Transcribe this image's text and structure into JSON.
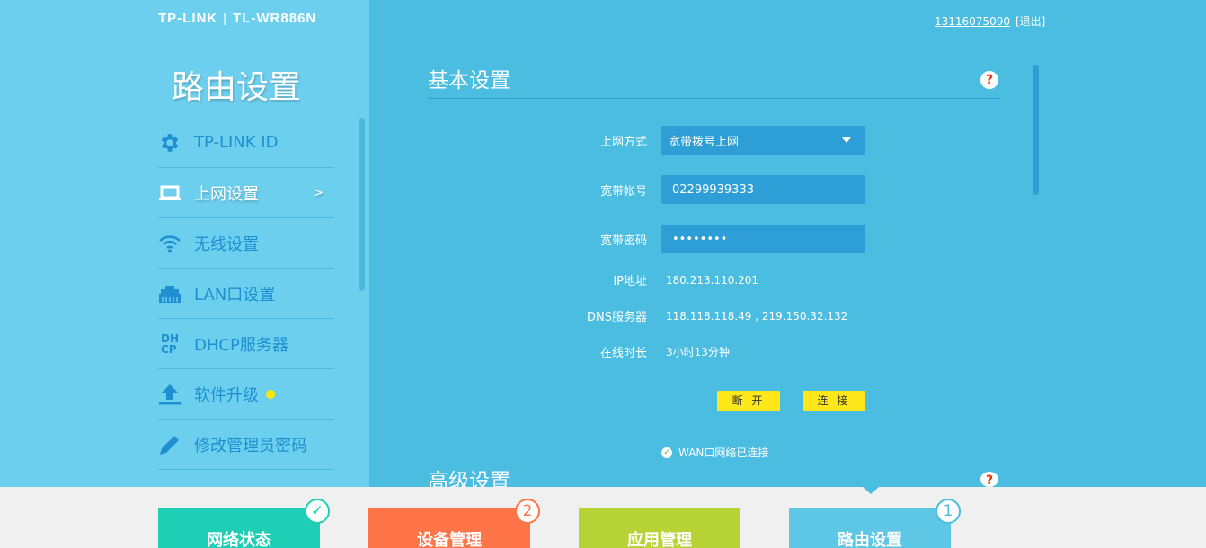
{
  "header": {
    "brand": "TP-LINK",
    "model": "TL-WR886N",
    "account": "13116075090",
    "logout": "[退出]"
  },
  "sidebar": {
    "title": "路由设置",
    "items": [
      {
        "label": "TP-LINK ID",
        "icon": "gear-icon"
      },
      {
        "label": "上网设置",
        "icon": "laptop-icon",
        "arrow": ">"
      },
      {
        "label": "无线设置",
        "icon": "wifi-icon"
      },
      {
        "label": "LAN口设置",
        "icon": "lan-port-icon"
      },
      {
        "label": "DHCP服务器",
        "icon": "dhcp-icon"
      },
      {
        "label": "软件升级",
        "icon": "upload-icon"
      },
      {
        "label": "修改管理员密码",
        "icon": "pencil-icon"
      }
    ]
  },
  "basic": {
    "title": "基本设置",
    "help": "?",
    "conn_type_label": "上网方式",
    "conn_type_value": "宽带拨号上网",
    "account_label": "宽带帐号",
    "account_value": "02299939333",
    "password_label": "宽带密码",
    "password_value": "••••••••",
    "ip_label": "IP地址",
    "ip_value": "180.213.110.201",
    "dns_label": "DNS服务器",
    "dns_value": "118.118.118.49 , 219.150.32.132",
    "uptime_label": "在线时长",
    "uptime_value": "3小时13分钟",
    "disconnect": "断 开",
    "connect": "连 接",
    "status": "WAN口网络已连接"
  },
  "advanced": {
    "title": "高级设置",
    "help": "?"
  },
  "tabs": [
    {
      "label": "网络状态",
      "badge": "✓",
      "color": "#1ecfb6"
    },
    {
      "label": "设备管理",
      "badge": "2",
      "color": "#ff7548"
    },
    {
      "label": "应用管理",
      "badge": "",
      "color": "#b8d335"
    },
    {
      "label": "路由设置",
      "badge": "1",
      "color": "#5ec7e5"
    }
  ]
}
